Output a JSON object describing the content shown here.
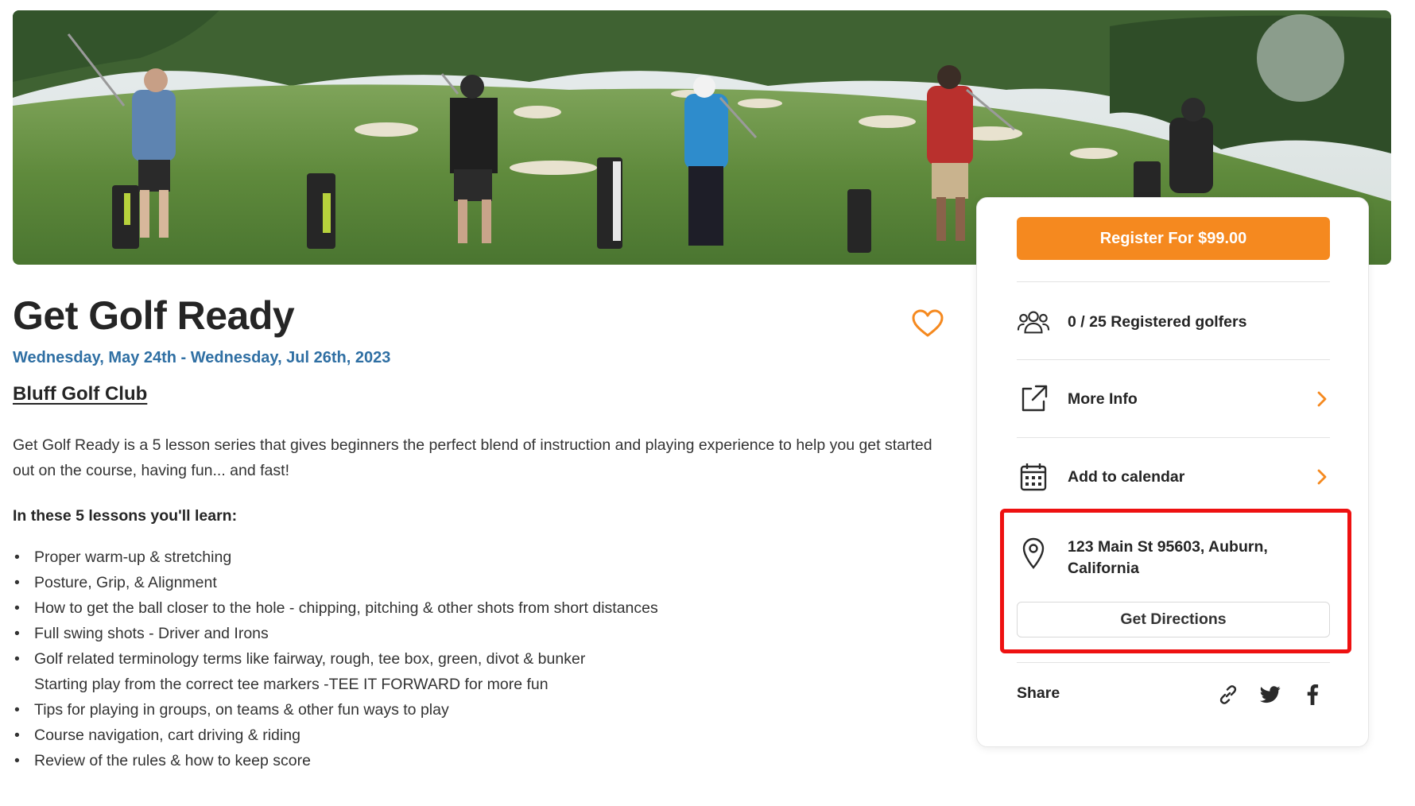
{
  "event": {
    "title": "Get Golf Ready",
    "dates": "Wednesday, May 24th - Wednesday, Jul 26th, 2023",
    "club": "Bluff Golf Club",
    "description": "Get Golf Ready is a 5 lesson series that gives beginners the perfect blend of instruction and playing experience to help you get started out on the course, having fun... and fast!",
    "learn_heading": "In these 5 lessons you'll learn:",
    "lessons": [
      "Proper warm-up & stretching",
      "Posture, Grip, & Alignment",
      "How to get the ball closer to the hole - chipping, pitching & other shots from short distances",
      "Full swing shots - Driver and Irons",
      "Golf related terminology terms like fairway, rough, tee box, green, divot & bunker",
      "Tips for playing in groups, on teams & other fun ways to play",
      "Course navigation, cart driving & riding",
      "Review of the rules & how to keep score"
    ],
    "lesson_continuation": "Starting play from the correct tee markers -TEE IT FORWARD for more fun",
    "bullet": "•"
  },
  "sidebar": {
    "register_label": "Register For $99.00",
    "registered": "0 / 25 Registered golfers",
    "more_info": "More Info",
    "add_to_calendar": "Add to calendar",
    "address": "123 Main St 95603, Auburn, California",
    "directions_label": "Get Directions",
    "share_label": "Share"
  },
  "colors": {
    "accent": "#f5891f",
    "date_blue": "#2f6fa3",
    "highlight": "#ee1111"
  },
  "icons": [
    "heart-icon",
    "users-icon",
    "external-link-icon",
    "calendar-icon",
    "map-pin-icon",
    "chevron-right-icon",
    "link-icon",
    "twitter-icon",
    "facebook-icon"
  ]
}
